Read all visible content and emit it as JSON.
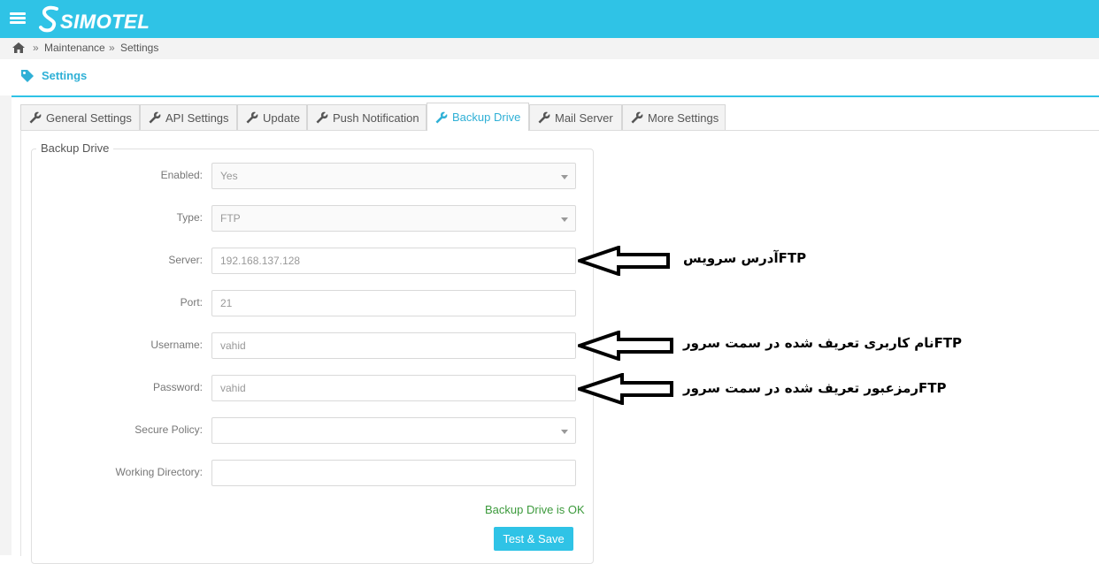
{
  "header": {
    "logo_text": "Simotel",
    "colors": {
      "accent": "#2fc3e6",
      "link": "#2fb0d6",
      "ok": "#3c9a3c"
    }
  },
  "breadcrumb": {
    "separator": "»",
    "items": [
      "Maintenance",
      "Settings"
    ]
  },
  "page": {
    "title": "Settings"
  },
  "tabs": [
    {
      "label": "General Settings",
      "icon": "wrench-icon"
    },
    {
      "label": "API Settings",
      "icon": "wrench-icon"
    },
    {
      "label": "Update",
      "icon": "wrench-icon"
    },
    {
      "label": "Push Notification",
      "icon": "wrench-icon"
    },
    {
      "label": "Backup Drive",
      "icon": "wrench-icon",
      "active": true
    },
    {
      "label": "Mail Server",
      "icon": "wrench-icon"
    },
    {
      "label": "More Settings",
      "icon": "wrench-icon"
    }
  ],
  "form": {
    "legend": "Backup Drive",
    "fields": [
      {
        "label": "Enabled:",
        "value": "Yes",
        "kind": "select"
      },
      {
        "label": "Type:",
        "value": "FTP",
        "kind": "select"
      },
      {
        "label": "Server:",
        "value": "192.168.137.128",
        "kind": "input"
      },
      {
        "label": "Port:",
        "value": "21",
        "kind": "input"
      },
      {
        "label": "Username:",
        "value": "vahid",
        "kind": "input"
      },
      {
        "label": "Password:",
        "value": "vahid",
        "kind": "input"
      },
      {
        "label": "Secure Policy:",
        "value": "",
        "kind": "select"
      },
      {
        "label": "Working Directory:",
        "value": "",
        "kind": "input"
      }
    ],
    "status": "Backup Drive is OK",
    "submit_label": "Test & Save"
  },
  "annotations": [
    {
      "text": "آدرس سرویس",
      "suffix": "FTP"
    },
    {
      "text": "نام کاربری تعریف شده در سمت سرور",
      "suffix": "FTP"
    },
    {
      "text": "رمزعبور تعریف شده در سمت سرور",
      "suffix": "FTP"
    }
  ]
}
